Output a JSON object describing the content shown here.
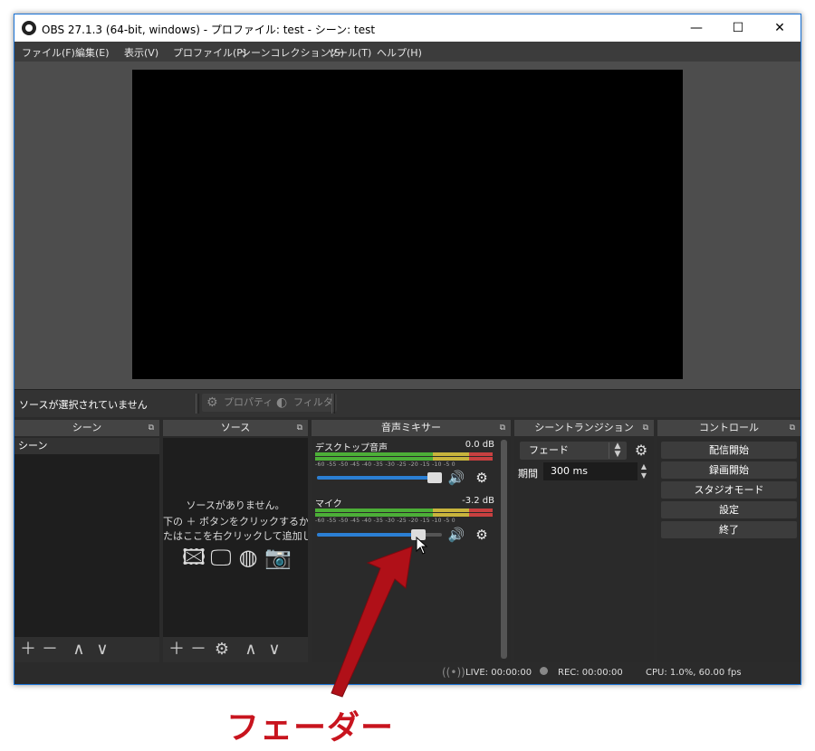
{
  "window": {
    "title": "OBS 27.1.3 (64-bit, windows) - プロファイル: test - シーン: test",
    "minimize": "—",
    "maximize": "☐",
    "close": "✕"
  },
  "menu": [
    "ファイル(F)",
    "編集(E)",
    "表示(V)",
    "プロファイル(P)",
    "シーンコレクション(S)",
    "ツール(T)",
    "ヘルプ(H)"
  ],
  "source_bar": {
    "no_source": "ソースが選択されていません",
    "properties": "プロパティ",
    "filters": "フィルタ"
  },
  "docks": {
    "scenes": {
      "title": "シーン",
      "items": [
        "シーン"
      ]
    },
    "sources": {
      "title": "ソース",
      "empty_line1": "ソースがありません。",
      "empty_line2": "下の ＋ ボタンをクリックするか、",
      "empty_line3": "たはここを右クリックして追加してください"
    },
    "mixer": {
      "title": "音声ミキサー",
      "channels": [
        {
          "name": "デスクトップ音声",
          "db": "0.0 dB",
          "level": 0.92
        },
        {
          "name": "マイク",
          "db": "-3.2 dB",
          "level": 0.8
        }
      ],
      "ticks": "-60 -55 -50 -45 -40 -35 -30 -25 -20 -15 -10 -5 0"
    },
    "transitions": {
      "title": "シーントランジション",
      "selected": "フェード",
      "duration_label": "期間",
      "duration_value": "300 ms"
    },
    "controls": {
      "title": "コントロール",
      "buttons": [
        "配信開始",
        "録画開始",
        "スタジオモード",
        "設定",
        "終了"
      ]
    }
  },
  "status": {
    "live": "LIVE: 00:00:00",
    "rec": "REC: 00:00:00",
    "cpu": "CPU: 1.0%, 60.00 fps"
  },
  "annotation": {
    "label": "フェーダー",
    "color": "#c8141e"
  }
}
